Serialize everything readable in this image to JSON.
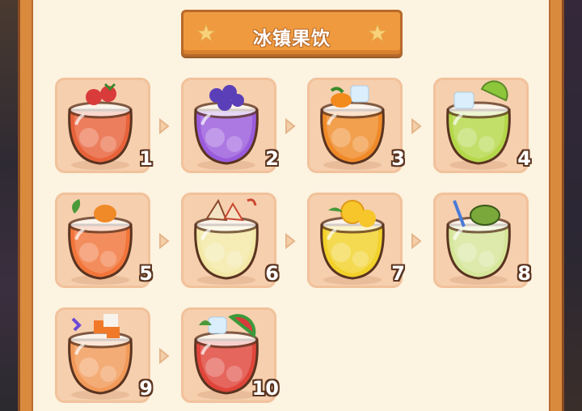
{
  "header": {
    "title": "冰镇果饮"
  },
  "drinks": [
    {
      "number": "1",
      "name": "strawberry-drink",
      "liquid": "#e8623a",
      "topping": "#d93b3b"
    },
    {
      "number": "2",
      "name": "blueberry-drink",
      "liquid": "#9a5bdc",
      "topping": "#5b3fb8"
    },
    {
      "number": "3",
      "name": "orange-drink",
      "liquid": "#f08a28",
      "topping": "#f28a1c"
    },
    {
      "number": "4",
      "name": "lime-drink",
      "liquid": "#b5d84a",
      "topping": "#8cc63a"
    },
    {
      "number": "5",
      "name": "carrot-drink",
      "liquid": "#f2753a",
      "topping": "#f08a28"
    },
    {
      "number": "6",
      "name": "apple-drink",
      "liquid": "#f3e8a6",
      "topping": "#c9462f"
    },
    {
      "number": "7",
      "name": "lemon-drink",
      "liquid": "#f2d22a",
      "topping": "#f7c62a"
    },
    {
      "number": "8",
      "name": "avocado-drink",
      "liquid": "#d6e69a",
      "topping": "#7aa83a"
    },
    {
      "number": "9",
      "name": "papaya-drink",
      "liquid": "#f29a5a",
      "topping": "#f07a2a"
    },
    {
      "number": "10",
      "name": "watermelon-drink",
      "liquid": "#e0453a",
      "topping": "#3a9a3a"
    }
  ]
}
